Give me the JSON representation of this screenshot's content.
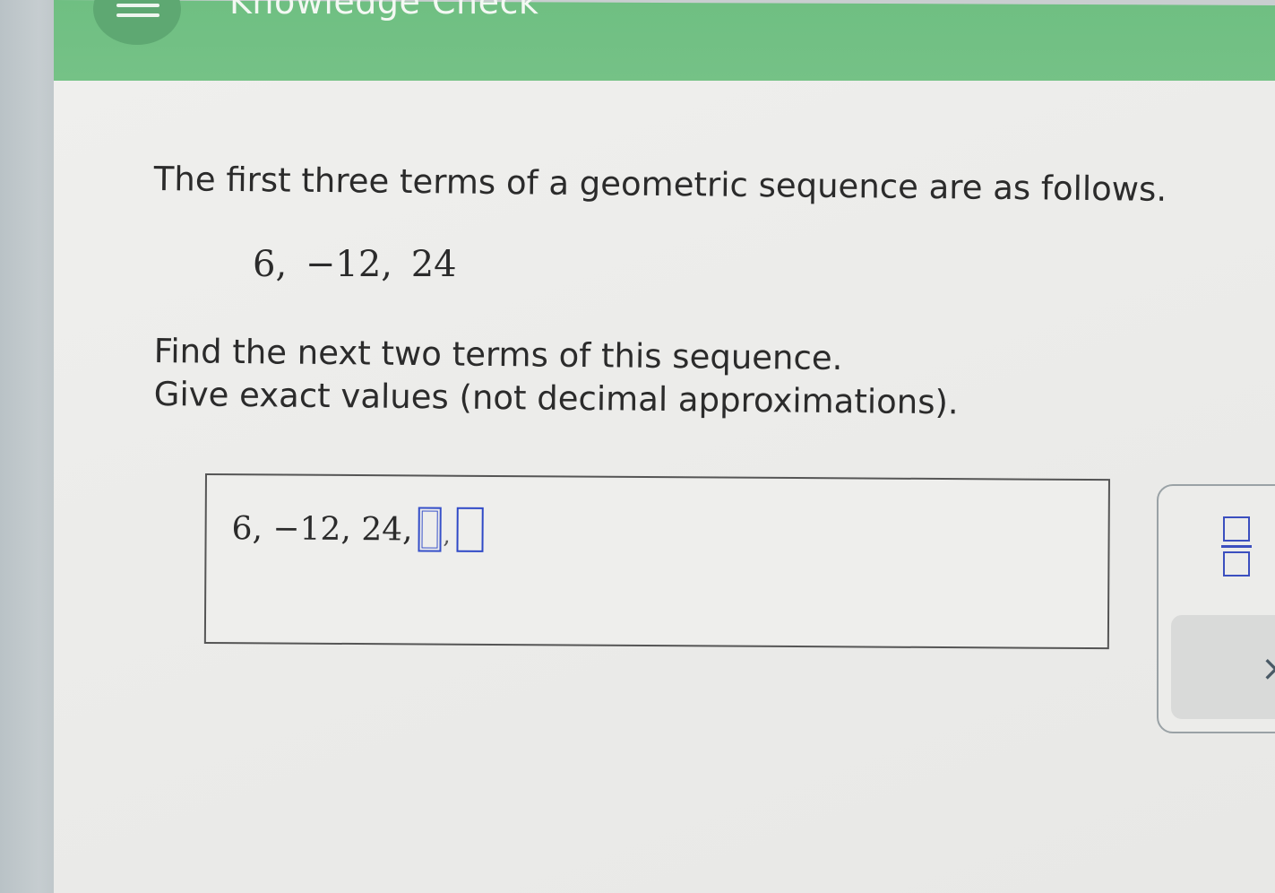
{
  "header": {
    "title": "Knowledge Check",
    "menu_icon": "hamburger-menu-icon",
    "color": "#72c084"
  },
  "question": {
    "prompt": "The first three terms of a geometric sequence are as follows.",
    "given_terms": "6,  −12,  24",
    "instruction_line1": "Find the next two terms of this sequence.",
    "instruction_line2": "Give exact values (not decimal approximations)."
  },
  "answer": {
    "prefix": "6, −12, 24,",
    "slot1_value": "",
    "separator": ",",
    "slot2_value": ""
  },
  "toolbar": {
    "fraction_icon": "fraction-icon",
    "clear_icon": "x-icon",
    "clear_label": "×"
  },
  "colors": {
    "accent_blue": "#3650c9",
    "header_green": "#72c084"
  }
}
